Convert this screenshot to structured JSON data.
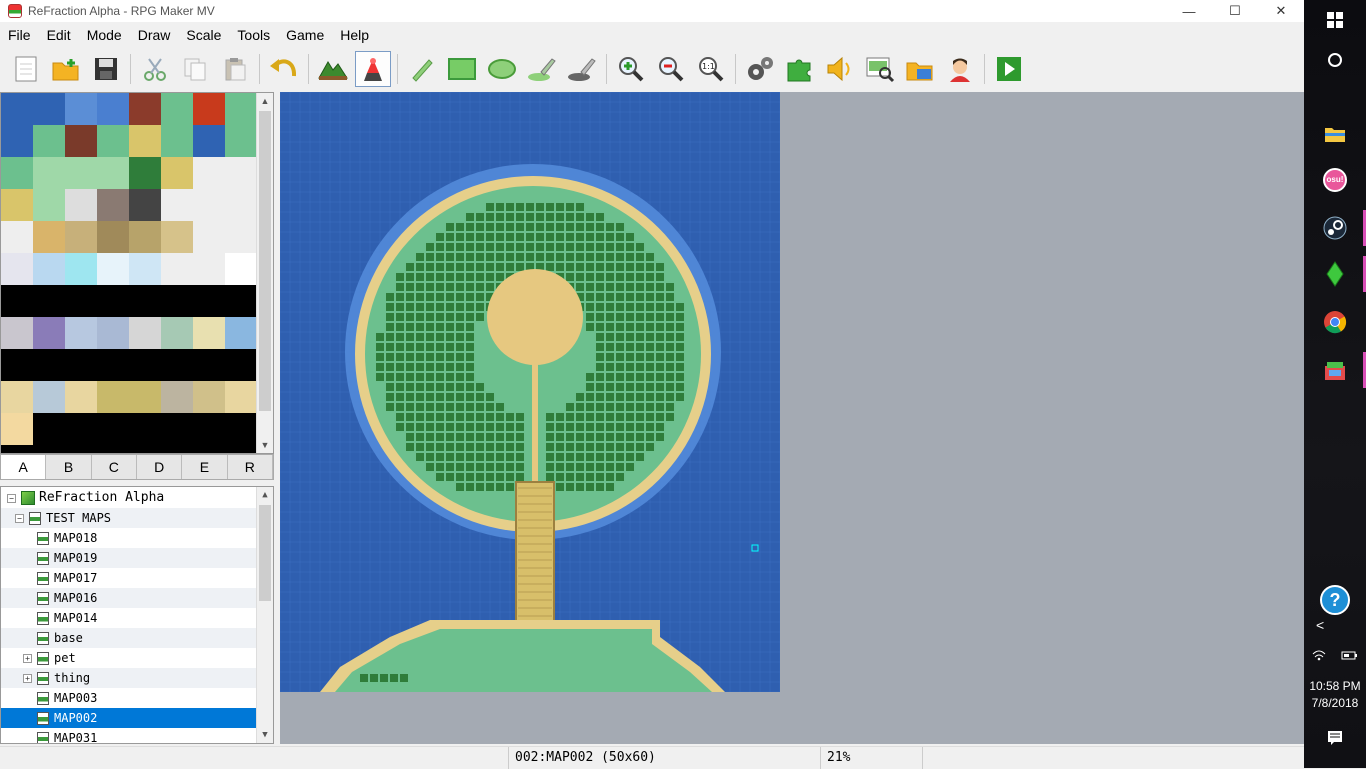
{
  "window": {
    "title": "ReFraction Alpha - RPG Maker MV",
    "minimize": "—",
    "maximize": "☐",
    "close": "✕"
  },
  "menu": [
    "File",
    "Edit",
    "Mode",
    "Draw",
    "Scale",
    "Tools",
    "Game",
    "Help"
  ],
  "toolbar": {
    "buttons": [
      "new-project",
      "open-project",
      "save-project",
      "cut",
      "copy",
      "paste",
      "undo",
      "map-mode",
      "event-mode",
      "pencil",
      "rectangle",
      "ellipse",
      "flood-fill",
      "shadow-pen",
      "zoom-in",
      "zoom-out",
      "actual-size",
      "database",
      "plugin-manager",
      "sound-test",
      "event-searcher",
      "resource-manager",
      "character-generator",
      "playtest"
    ],
    "active": "event-mode"
  },
  "tileset": {
    "tabs": [
      "A",
      "B",
      "C",
      "D",
      "E",
      "R"
    ],
    "active_tab": "A"
  },
  "tree": {
    "project": "ReFraction Alpha",
    "items": [
      {
        "label": "TEST MAPS",
        "level": 1,
        "expander": "−"
      },
      {
        "label": "MAP018",
        "level": 2
      },
      {
        "label": "MAP019",
        "level": 2
      },
      {
        "label": "MAP017",
        "level": 2
      },
      {
        "label": "MAP016",
        "level": 2
      },
      {
        "label": "MAP014",
        "level": 2
      },
      {
        "label": "base",
        "level": 2
      },
      {
        "label": "pet",
        "level": 2,
        "expander": "+"
      },
      {
        "label": "thing",
        "level": 2,
        "expander": "+"
      },
      {
        "label": "MAP003",
        "level": 2
      },
      {
        "label": "MAP002",
        "level": 2,
        "selected": true
      },
      {
        "label": "MAP031",
        "level": 2
      }
    ]
  },
  "status": {
    "map": "002:MAP002 (50x60)",
    "zoom": "21%"
  },
  "taskbar": {
    "apps": [
      "windows-start",
      "cortana",
      "file-explorer",
      "osu",
      "steam",
      "sims",
      "chrome",
      "game-app"
    ],
    "osu_label": "osu!",
    "help": "?",
    "chevron": "<",
    "time": "10:58 PM",
    "date": "7/8/2018"
  },
  "colors": {
    "water": "#2f5fb0",
    "grass": "#6cc08e",
    "sand": "#e6cf8a",
    "tree": "#2f7d3a",
    "selection": "#0078d7",
    "canvas_bg": "#a4aab3"
  }
}
